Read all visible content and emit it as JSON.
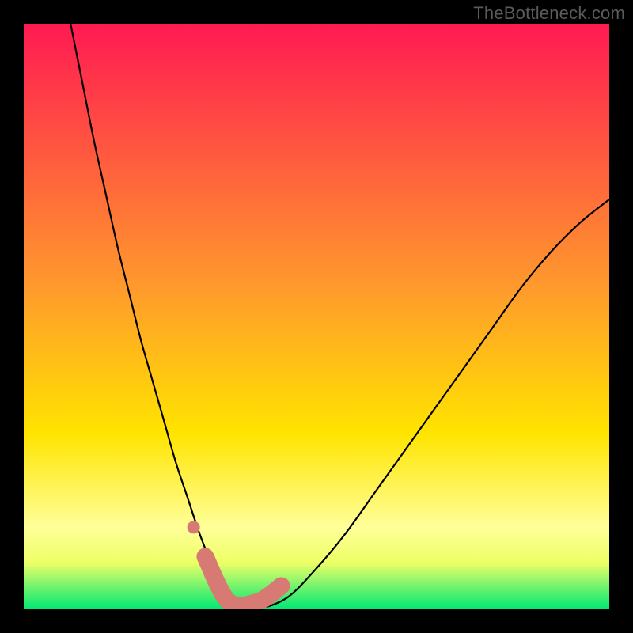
{
  "watermark": "TheBottleneck.com",
  "colors": {
    "frame": "#000000",
    "grad_top": "#ff1a52",
    "grad_mid1": "#ff7a2c",
    "grad_mid2": "#ffe400",
    "grad_low": "#ffff99",
    "grad_bottom": "#00e874",
    "curve": "#000000",
    "marker": "#d87a74"
  },
  "chart_data": {
    "type": "line",
    "title": "",
    "xlabel": "",
    "ylabel": "",
    "xlim": [
      0,
      100
    ],
    "ylim": [
      0,
      100
    ],
    "series": [
      {
        "name": "bottleneck-curve",
        "x": [
          8,
          10,
          12,
          14,
          16,
          18,
          20,
          22,
          24,
          26,
          28,
          30,
          32,
          34,
          36,
          38,
          40,
          45,
          50,
          55,
          60,
          65,
          70,
          75,
          80,
          85,
          90,
          95,
          100
        ],
        "y": [
          100,
          90,
          80,
          71,
          62,
          54,
          46,
          39,
          32,
          25,
          19,
          13,
          8,
          4,
          1,
          0,
          0,
          2,
          7,
          13,
          20,
          27,
          34,
          41,
          48,
          55,
          61,
          66,
          70
        ]
      }
    ],
    "markers": [
      {
        "name": "left-dot",
        "x": 29,
        "y": 14
      },
      {
        "name": "valley-left-start",
        "x": 31,
        "y": 9
      },
      {
        "name": "valley-bottom-1",
        "x": 35,
        "y": 1.3
      },
      {
        "name": "valley-bottom-2",
        "x": 40,
        "y": 1.3
      },
      {
        "name": "valley-right-end",
        "x": 44,
        "y": 4
      }
    ],
    "gradient_stops": [
      {
        "pct": 0,
        "color": "#ff1a52"
      },
      {
        "pct": 45,
        "color": "#ff9a2c"
      },
      {
        "pct": 70,
        "color": "#ffe400"
      },
      {
        "pct": 86,
        "color": "#ffff99"
      },
      {
        "pct": 92,
        "color": "#eeff66"
      },
      {
        "pct": 100,
        "color": "#00e874"
      }
    ]
  }
}
